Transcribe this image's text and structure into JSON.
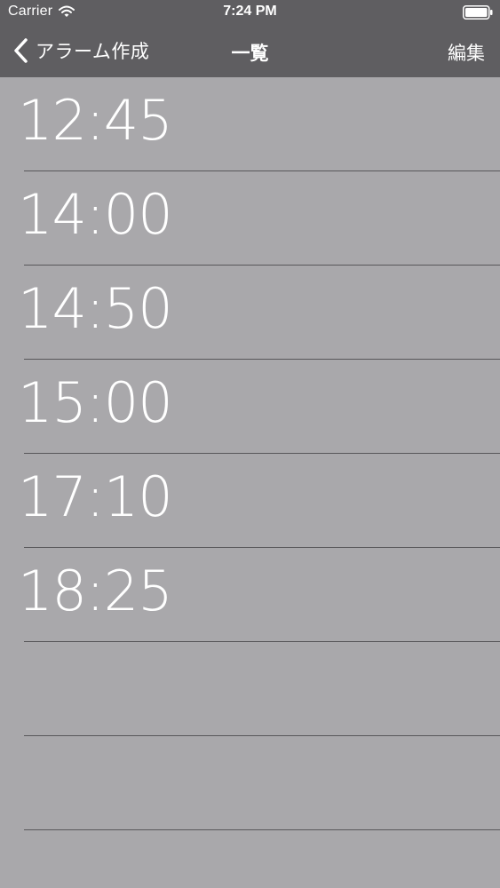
{
  "status_bar": {
    "carrier": "Carrier",
    "time": "7:24 PM",
    "wifi_icon": "wifi-icon",
    "battery_icon": "battery-full-icon"
  },
  "nav": {
    "back_label": "アラーム作成",
    "back_icon": "chevron-left-icon",
    "title": "一覧",
    "edit_label": "編集"
  },
  "alarms": [
    {
      "time": "12:45"
    },
    {
      "time": "14:00"
    },
    {
      "time": "14:50"
    },
    {
      "time": "15:00"
    },
    {
      "time": "17:10"
    },
    {
      "time": "18:25"
    },
    {
      "time": ""
    },
    {
      "time": ""
    }
  ],
  "colors": {
    "nav_background": "#5f5e61",
    "list_background": "#a9a8ab",
    "separator": "#58575a",
    "text": "#ffffff"
  }
}
